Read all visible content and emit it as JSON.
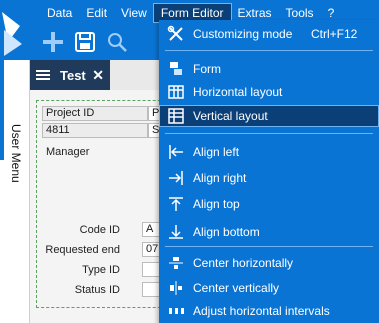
{
  "menubar": {
    "items": [
      {
        "label": "Data"
      },
      {
        "label": "Edit"
      },
      {
        "label": "View"
      },
      {
        "label": "Form Editor"
      },
      {
        "label": "Extras"
      },
      {
        "label": "Tools"
      },
      {
        "label": "?"
      }
    ],
    "active_index": 3
  },
  "toolbar": {
    "icons": [
      "add-icon",
      "save-icon",
      "search-icon"
    ]
  },
  "side_panel": {
    "label": "User Menu"
  },
  "tab": {
    "label": "Test",
    "close": "✕"
  },
  "form": {
    "rows": [
      {
        "label": "Project ID",
        "value": "P"
      },
      {
        "label": "4811",
        "value": "S"
      },
      {
        "label": "Manager",
        "value": ""
      }
    ],
    "lower_fields": [
      {
        "label": "Code ID",
        "value": "A"
      },
      {
        "label": "Requested end",
        "value": "07"
      },
      {
        "label": "Type ID",
        "value": ""
      },
      {
        "label": "Status ID",
        "value": ""
      }
    ]
  },
  "dropdown": {
    "items": [
      {
        "label": "Customizing mode",
        "shortcut": "Ctrl+F12",
        "icon": "tools-icon"
      },
      {
        "label": "Form",
        "icon": "form-icon"
      },
      {
        "label": "Horizontal layout",
        "icon": "horizontal-layout-icon"
      },
      {
        "label": "Vertical layout",
        "icon": "vertical-layout-icon",
        "selected": true
      },
      {
        "label": "Align left",
        "icon": "align-left-icon"
      },
      {
        "label": "Align right",
        "icon": "align-right-icon"
      },
      {
        "label": "Align top",
        "icon": "align-top-icon"
      },
      {
        "label": "Align bottom",
        "icon": "align-bottom-icon"
      },
      {
        "label": "Center horizontally",
        "icon": "center-horizontally-icon"
      },
      {
        "label": "Center vertically",
        "icon": "center-vertically-icon"
      },
      {
        "label": "Adjust horizontal intervals",
        "icon": "adjust-horizontal-intervals-icon"
      }
    ]
  },
  "colors": {
    "accent": "#0a74d4",
    "menu_active": "#0a3f78",
    "tab_bg": "#1f3a5a",
    "form_border": "#5aa35a"
  }
}
